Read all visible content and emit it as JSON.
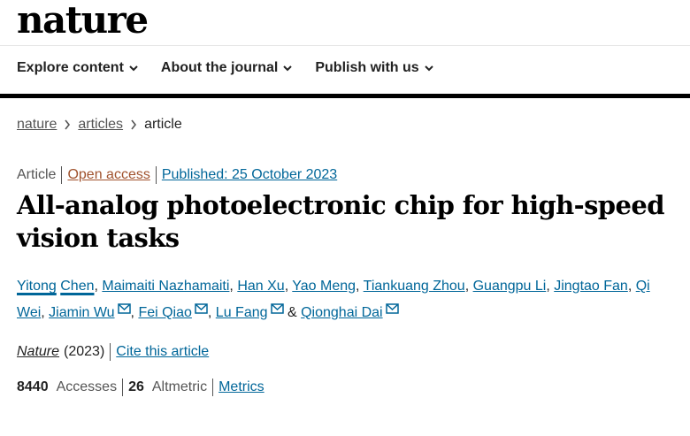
{
  "brand": {
    "logo_text": "nature"
  },
  "nav": {
    "items": [
      {
        "label": "Explore content"
      },
      {
        "label": "About the journal"
      },
      {
        "label": "Publish with us"
      }
    ]
  },
  "breadcrumb": {
    "items": [
      "nature",
      "articles",
      "article"
    ]
  },
  "article_meta": {
    "type": "Article",
    "access": "Open access",
    "published": "Published: 25 October 2023"
  },
  "title": "All-analog photoelectronic chip for high-speed vision tasks",
  "authors": [
    {
      "first": "Yitong",
      "last": "Chen",
      "email": false
    },
    {
      "name": "Maimaiti Nazhamaiti",
      "email": false
    },
    {
      "name": "Han Xu",
      "email": false
    },
    {
      "name": "Yao Meng",
      "email": false
    },
    {
      "name": "Tiankuang Zhou",
      "email": false
    },
    {
      "name": "Guangpu Li",
      "email": false
    },
    {
      "name": "Jingtao Fan",
      "email": false
    },
    {
      "name": "Qi Wei",
      "email": false
    },
    {
      "name": "Jiamin Wu",
      "email": true
    },
    {
      "name": "Fei Qiao",
      "email": true
    },
    {
      "name": "Lu Fang",
      "email": true
    },
    {
      "name": "Qionghai Dai",
      "email": true
    }
  ],
  "authors_connector": "&",
  "journal": {
    "name": "Nature",
    "year": "(2023)",
    "cite_label": "Cite this article"
  },
  "metrics": {
    "accesses_value": "8440",
    "accesses_label": "Accesses",
    "altmetric_value": "26",
    "altmetric_label": "Altmetric",
    "metrics_link": "Metrics"
  },
  "colors": {
    "link": "#006699",
    "open_access": "#a0522d",
    "text": "#222222"
  },
  "icons": {
    "nav_chevron": "chevron-down-icon",
    "crumb_separator": "chevron-right-icon",
    "author_mail": "envelope-icon"
  }
}
